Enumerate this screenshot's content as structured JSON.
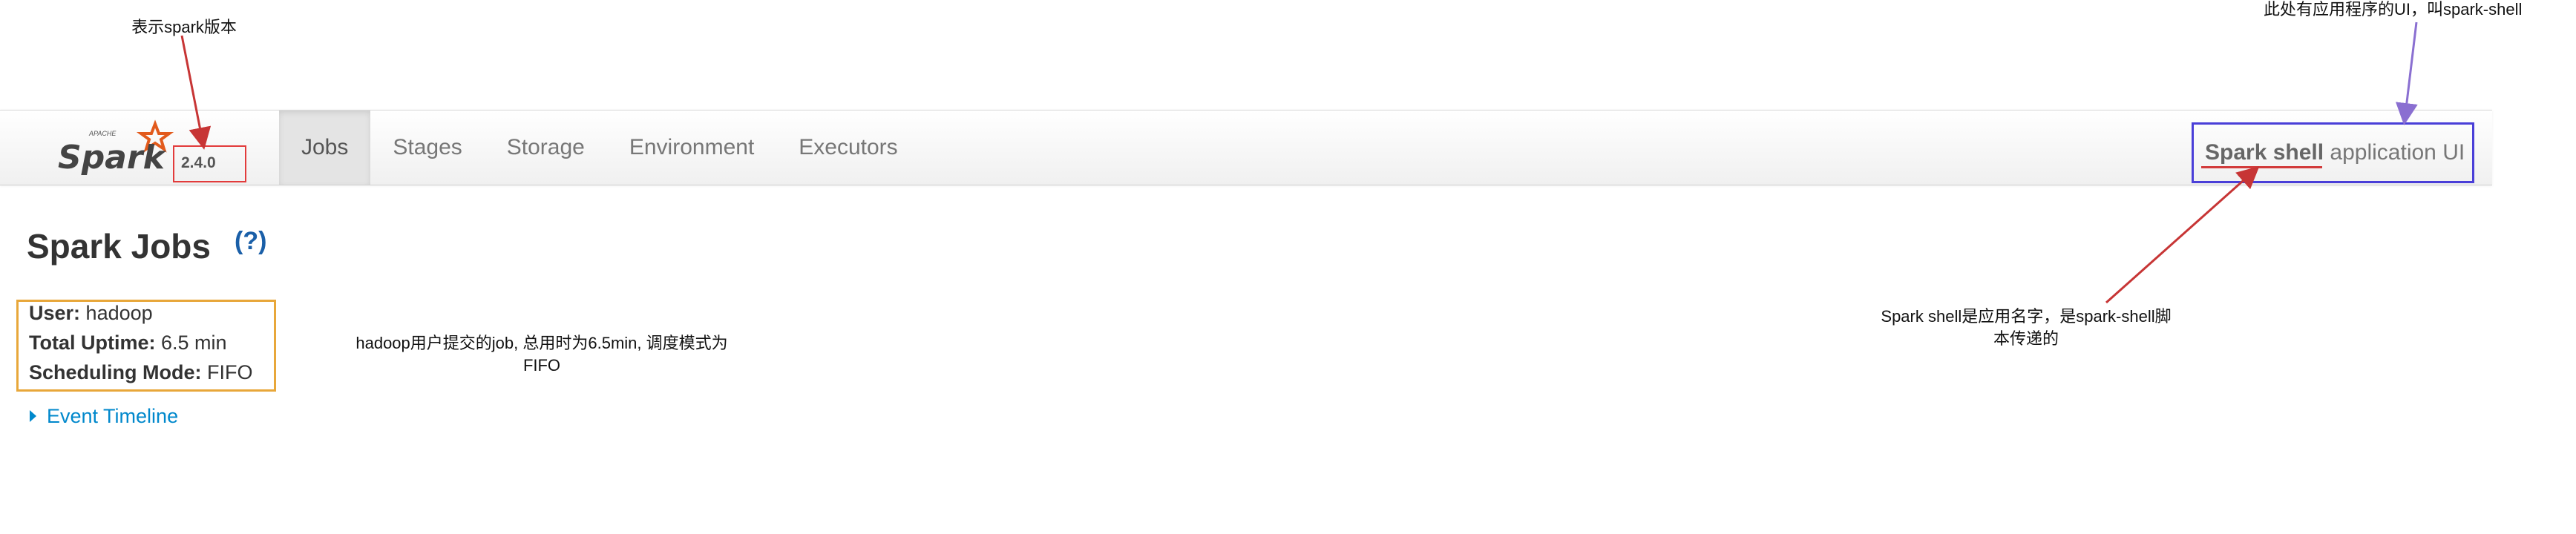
{
  "navbar": {
    "brand": {
      "logo_word": "Spark",
      "logo_small": "APACHE",
      "version": "2.4.0"
    },
    "tabs": [
      {
        "label": "Jobs",
        "active": true
      },
      {
        "label": "Stages",
        "active": false
      },
      {
        "label": "Storage",
        "active": false
      },
      {
        "label": "Environment",
        "active": false
      },
      {
        "label": "Executors",
        "active": false
      }
    ],
    "app_name": "Spark shell",
    "app_suffix": "application UI"
  },
  "content": {
    "title": "Spark Jobs",
    "help": "(?)",
    "info": {
      "user_label": "User:",
      "user_value": "hadoop",
      "uptime_label": "Total Uptime:",
      "uptime_value": "6.5 min",
      "mode_label": "Scheduling Mode:",
      "mode_value": "FIFO"
    },
    "event_timeline": "Event Timeline"
  },
  "annotations": {
    "version_note": "表示spark版本",
    "app_ui_note": "此处有应用程序的UI，叫spark-shell",
    "job_note_line1": "hadoop用户提交的job, 总用时为6.5min, 调度模式为",
    "job_note_line2": "FIFO",
    "app_name_note_line1": "Spark shell是应用名字，是spark-shell脚",
    "app_name_note_line2": "本传递的"
  },
  "colors": {
    "annotation_red": "#e23b3b",
    "annotation_orange": "#e8a73a",
    "annotation_blue": "#4a3fd8",
    "arrow_purple": "#8a6fd1",
    "link_blue": "#0088cc",
    "logo_orange": "#e25a1c"
  }
}
